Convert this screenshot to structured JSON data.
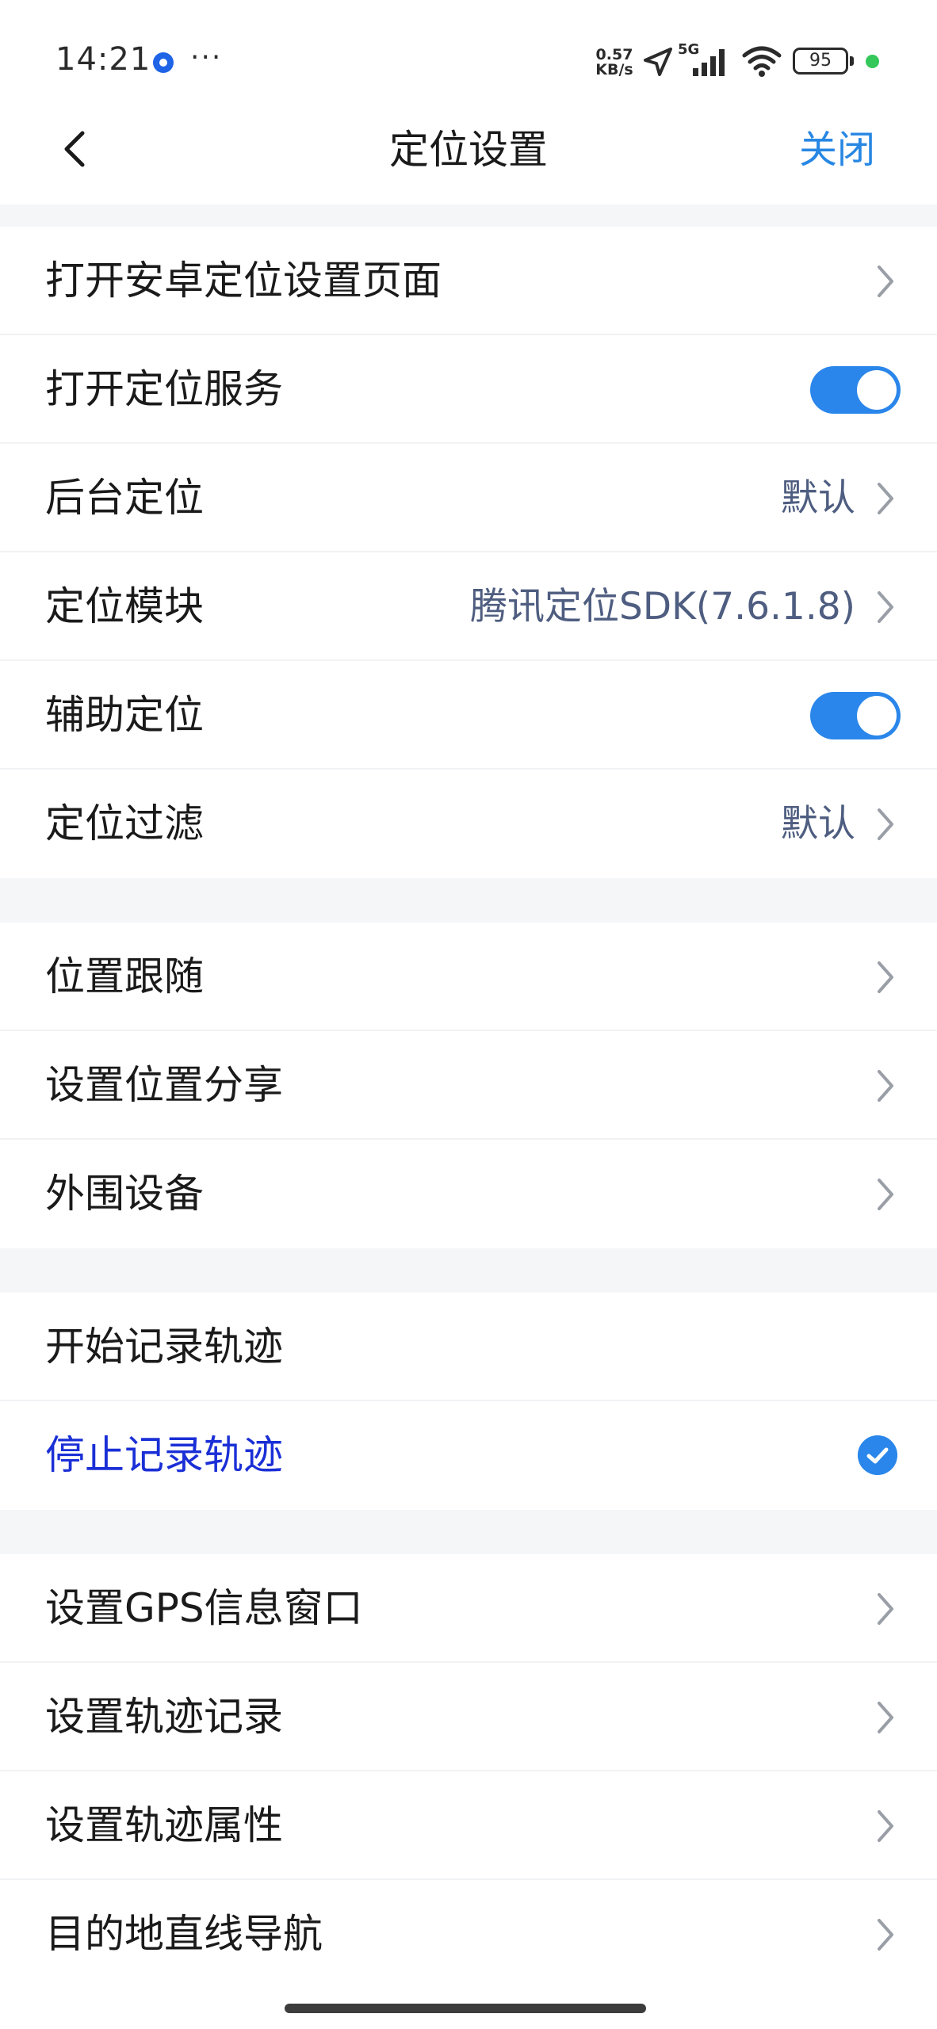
{
  "status_bar": {
    "time": "14:21",
    "more": "···",
    "net_speed_value": "0.57",
    "net_speed_unit": "KB/s",
    "network": "5G",
    "battery": "95",
    "icons": [
      "app-notification-icon",
      "location-arrow-icon",
      "signal-icon",
      "wifi-icon",
      "battery-icon",
      "active-dot-icon"
    ]
  },
  "nav": {
    "title": "定位设置",
    "close_label": "关闭",
    "back_icon": "chevron-left-icon"
  },
  "section1": {
    "items": [
      {
        "label": "打开安卓定位设置页面",
        "control": "chevron"
      },
      {
        "label": "打开定位服务",
        "control": "toggle",
        "state": "on"
      },
      {
        "label": "后台定位",
        "value": "默认",
        "control": "chevron"
      },
      {
        "label": "定位模块",
        "value": "腾讯定位SDK(7.6.1.8)",
        "control": "chevron"
      },
      {
        "label": "辅助定位",
        "control": "toggle",
        "state": "on"
      },
      {
        "label": "定位过滤",
        "value": "默认",
        "control": "chevron"
      }
    ]
  },
  "section2": {
    "items": [
      {
        "label": "位置跟随",
        "control": "chevron"
      },
      {
        "label": "设置位置分享",
        "control": "chevron"
      },
      {
        "label": "外围设备",
        "control": "chevron"
      }
    ]
  },
  "section3": {
    "items": [
      {
        "label": "开始记录轨迹",
        "control": "none"
      },
      {
        "label": "停止记录轨迹",
        "control": "check",
        "state": "selected"
      }
    ]
  },
  "section4": {
    "items": [
      {
        "label": "设置GPS信息窗口",
        "control": "chevron"
      },
      {
        "label": "设置轨迹记录",
        "control": "chevron"
      },
      {
        "label": "设置轨迹属性",
        "control": "chevron"
      },
      {
        "label": "目的地直线导航",
        "control": "chevron"
      }
    ]
  },
  "colors": {
    "accent": "#2a86ea",
    "selected_text": "#1a2fd6",
    "value_text": "#4e5d80",
    "section_gap": "#f5f6f8"
  }
}
